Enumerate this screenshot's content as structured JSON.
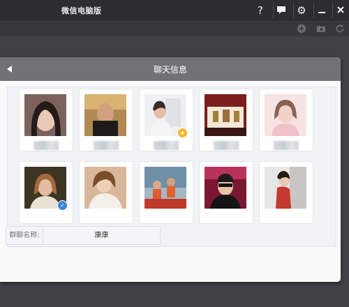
{
  "window": {
    "title": "微信电脑版",
    "buttons": [
      "?",
      "⊡",
      "⚙",
      "—",
      "✕"
    ]
  },
  "panel": {
    "title": "聊天信息",
    "group_name_label": "群聊名称:",
    "group_name_value": "康康"
  },
  "members": [
    {
      "name": ""
    },
    {
      "name": ""
    },
    {
      "name": ""
    },
    {
      "name": ""
    },
    {
      "name": ""
    },
    {
      "name": ""
    },
    {
      "name": ""
    },
    {
      "name": ""
    },
    {
      "name": ""
    },
    {
      "name": ""
    }
  ],
  "colors": {
    "titlebar": "#2b2d30",
    "panel_header": "#6f7377",
    "badge_gold": "#f3b728",
    "badge_blue": "#3a88d8"
  }
}
